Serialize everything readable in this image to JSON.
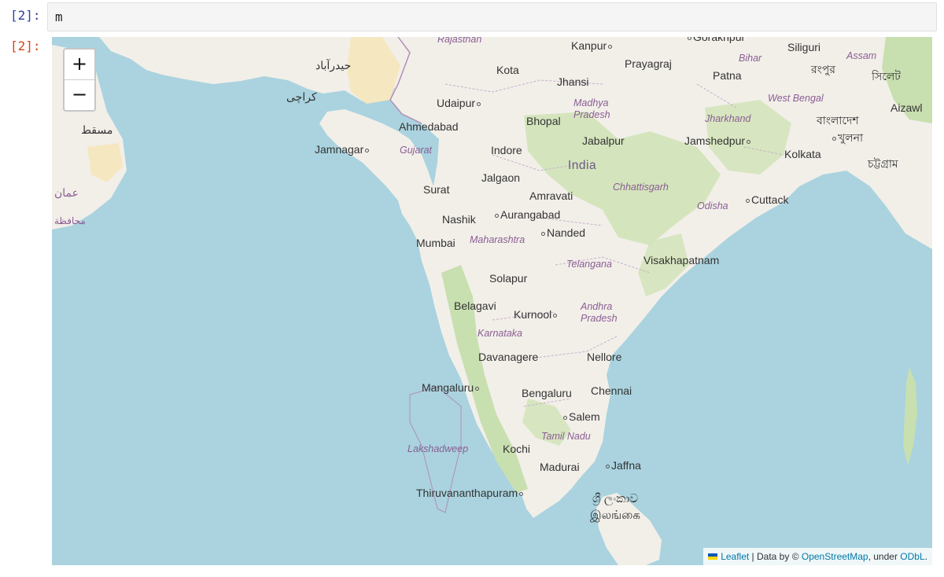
{
  "notebook": {
    "input_prompt": "[2]:",
    "output_prompt": "[2]:",
    "cell_code": "m"
  },
  "map": {
    "zoom_in_label": "+",
    "zoom_out_label": "−",
    "attribution": {
      "leaflet_link": "Leaflet",
      "separator": " | Data by © ",
      "osm_link": "OpenStreetMap",
      "under_text": ", under ",
      "license_link": "ODbL",
      "end": "."
    },
    "colors": {
      "water": "#aad3df",
      "land": "#f2efe9",
      "forest": "#c8dfb0",
      "desert": "#f5e7c0",
      "border": "#b08fb8"
    },
    "labels": {
      "rajasthan": "Rajasthan",
      "kanpur": "Kanpur",
      "gorakhpur": "Gorakhpur",
      "siliguri": "Siliguri",
      "hyderabad_pk": "حیدرآباد",
      "kota": "Kota",
      "prayagraj": "Prayagraj",
      "bihar": "Bihar",
      "assam": "Assam",
      "rangpur": "রংপুর",
      "sylhet": "সিলেট",
      "patna": "Patna",
      "jhansi": "Jhansi",
      "karachi": "کراچی",
      "udaipur": "Udaipur",
      "madhya_pradesh_1": "Madhya",
      "madhya_pradesh_2": "Pradesh",
      "west_bengal": "West Bengal",
      "aizawl": "Aizawl",
      "ahmedabad": "Ahmedabad",
      "bhopal": "Bhopal",
      "jharkhand": "Jharkhand",
      "bangladesh": "বাংলাদেশ",
      "muscat": "مسقط",
      "khulna": "খুলনা",
      "jamnagar": "Jamnagar",
      "gujarat": "Gujarat",
      "indore": "Indore",
      "jabalpur": "Jabalpur",
      "jamshedpur": "Jamshedpur",
      "kolkata": "Kolkata",
      "chittagong": "চট্টগ্রাম",
      "india": "India",
      "jalgaon": "Jalgaon",
      "oman": "عمان",
      "surat": "Surat",
      "chhattisgarh": "Chhattisgarh",
      "amravati": "Amravati",
      "muhafazah": "محافظة",
      "odisha": "Odisha",
      "cuttack": "Cuttack",
      "nashik": "Nashik",
      "aurangabad": "Aurangabad",
      "nanded": "Nanded",
      "mumbai": "Mumbai",
      "maharashtra": "Maharashtra",
      "telangana": "Telangana",
      "visakhapatnam": "Visakhapatnam",
      "solapur": "Solapur",
      "belagavi": "Belagavi",
      "andhra_1": "Andhra",
      "andhra_2": "Pradesh",
      "kurnool": "Kurnool",
      "karnataka": "Karnataka",
      "davanagere": "Davanagere",
      "nellore": "Nellore",
      "mangaluru": "Mangaluru",
      "bengaluru": "Bengaluru",
      "chennai": "Chennai",
      "salem": "Salem",
      "tamil_nadu": "Tamil Nadu",
      "lakshadweep": "Lakshadweep",
      "kochi": "Kochi",
      "madurai": "Madurai",
      "jaffna": "Jaffna",
      "thiruvananthapuram": "Thiruvananthapuram",
      "sri_lanka_sinhala": "ශ්‍රී ලංකාව",
      "sri_lanka_tamil": "இலங்கை"
    }
  }
}
